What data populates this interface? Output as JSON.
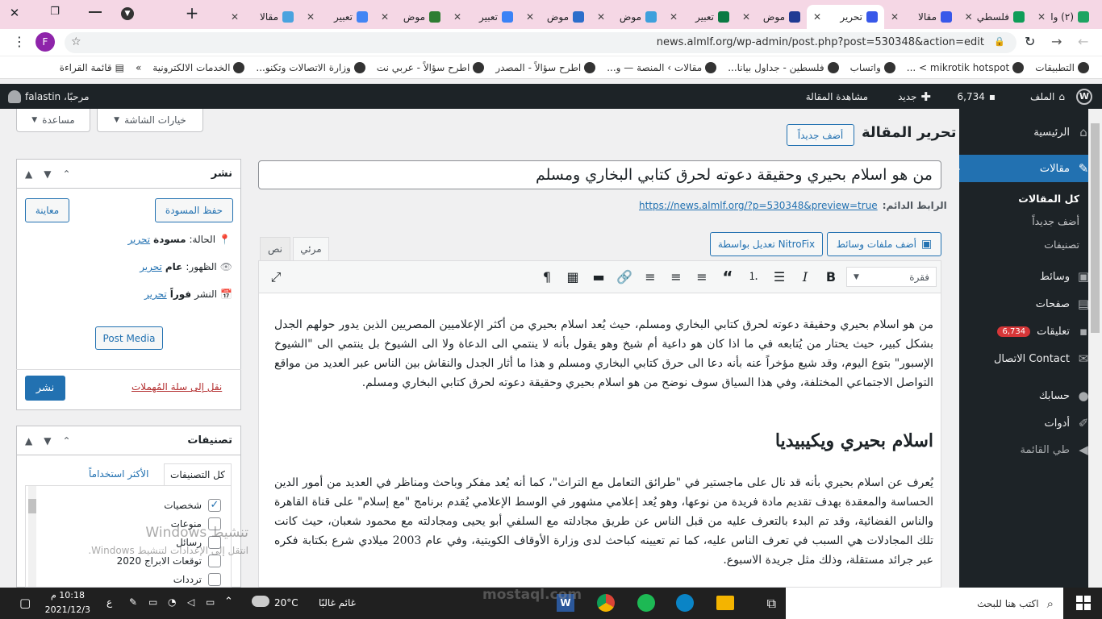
{
  "browser": {
    "tabs": [
      {
        "label": "(٢) وا",
        "color": "#1da462"
      },
      {
        "label": "فلسطي",
        "color": "#0f9d58"
      },
      {
        "label": "مقالا",
        "color": "#3858e9"
      },
      {
        "label": "تحرير",
        "color": "#3858e9",
        "active": true
      },
      {
        "label": "موض",
        "color": "#1f3a93"
      },
      {
        "label": "تعبير",
        "color": "#0b7a43"
      },
      {
        "label": "موض",
        "color": "#3ea0dc"
      },
      {
        "label": "موض",
        "color": "#2c6ecb"
      },
      {
        "label": "تعبير",
        "color": "#3b82f6"
      },
      {
        "label": "موض",
        "color": "#2e7d32"
      },
      {
        "label": "تعبير",
        "color": "#4285f4"
      },
      {
        "label": "مقالا",
        "color": "#4aa3df"
      }
    ],
    "url": "news.almlf.org/wp-admin/post.php?post=530348&action=edit",
    "profile_letter": "F",
    "bookmarks": [
      "التطبيقات",
      "mikrotik hotspot > ...",
      "واتساب",
      "فلسطين - جداول بيانا...",
      "مقالات › المنصة — و...",
      "اطرح سؤالاً - المصدر",
      "اطرح سؤالاً - عربي نت",
      "وزارة الاتصالات وتكنو...",
      "الخدمات الالكترونية"
    ],
    "bookmarks_more": "»",
    "reading_list": "قائمة القراءة"
  },
  "adminbar": {
    "site": "الملف",
    "comments": "6,734",
    "new": "جديد",
    "view": "مشاهدة المقالة",
    "greeting": "مرحبًا، falastin"
  },
  "sidebar": {
    "items": [
      {
        "label": "الرئيسية",
        "icon": "⌂"
      },
      {
        "label": "مقالات",
        "icon": "✎"
      },
      {
        "label": "وسائط",
        "icon": "▣"
      },
      {
        "label": "صفحات",
        "icon": "▤"
      },
      {
        "label": "تعليقات",
        "icon": "✉"
      },
      {
        "label": "Contact الاتصال",
        "icon": "✉"
      },
      {
        "label": "حسابك",
        "icon": "●"
      },
      {
        "label": "أدوات",
        "icon": "✐"
      },
      {
        "label": "طي القائمة",
        "icon": "◀"
      }
    ],
    "sub": [
      "كل المقالات",
      "أضف جديداً",
      "تصنيفات"
    ],
    "comments_badge": "6,734"
  },
  "top": {
    "screen_options": "خيارات الشاشة",
    "help": "مساعدة",
    "page_title": "تحرير المقالة",
    "add_new": "أضف جديداً"
  },
  "post": {
    "title": "من هو اسلام بحيري وحقيقة دعوته لحرق كتابي البخاري ومسلم",
    "permalink_label": "الرابط الدائم:",
    "permalink": "https://news.almlf.org/?p=530348&preview=true",
    "add_media": "أضف ملفات وسائط",
    "nitrofix": "تعديل بواسطة NitroFix",
    "tab_visual": "مرئي",
    "tab_text": "نص",
    "format": "فقرة",
    "para1": "من هو اسلام بحيري وحقيقة دعوته لحرق كتابي البخاري ومسلم، حيث يُعد اسلام بحيري من أكثر الإعلاميين المصريين الذين يدور حولهم الجدل بشكل كبير، حيث يحتار من يُتابعه في ما اذا كان هو داعية أم شيخ وهو يقول بأنه لا ينتمي الى الدعاة ولا الى الشيوخ بل ينتمي الى \"الشيوخ الإسبور\" بتوع اليوم، وقد شيع مؤخراً عنه بأنه دعا الى حرق كتابي البخاري ومسلم و هذا ما أثار الجدل والنقاش بين الناس عبر العديد من مواقع التواصل الاجتماعي المختلفة، وفي هذا السياق سوف نوضح من هو اسلام بحيري وحقيقة دعوته لحرق كتابي البخاري ومسلم.",
    "heading": "اسلام بحيري ويكيبيديا",
    "para2": "يُعرف عن اسلام بحيري بأنه قد نال على ماجستير في \"طرائق التعامل مع التراث\"، كما أنه يُعد مفكر وباحث ومناظر في العديد من أمور الدين الحساسة والمعقدة بهدف تقديم مادة فريدة من نوعها، وهو يُعد إعلامي مشهور في الوسط الإعلامي يُقدم برنامج \"مع إسلام\" على قناة القاهرة والناس الفضائية، وقد تم البدء بالتعرف عليه من قبل الناس عن طريق مجادلته مع السلفي أبو يحيى ومجادلته مع محمود شعبان، حيث كانت تلك المجادلات هي السبب في تعرف الناس عليه، كما تم تعيينه كباحث لدى وزارة الأوقاف الكويتية، وفي عام 2003 ميلادي شرع بكتابة فكره عبر جرائد مستقلة، وذلك مثل جريدة الاسبوع."
  },
  "publish": {
    "title": "نشر",
    "save_draft": "حفظ المسودة",
    "preview": "معاينة",
    "status_label": "الحالة:",
    "status_value": "مسودة",
    "visibility_label": "الظهور:",
    "visibility_value": "عام",
    "schedule_label": "النشر",
    "schedule_value": "فوراً",
    "edit": "تحرير",
    "post_media": "Post Media",
    "trash": "نقل إلى سلة المُهملات",
    "publish_btn": "نشر"
  },
  "categories": {
    "title": "تصنيفات",
    "tab_all": "كل التصنيفات",
    "tab_popular": "الأكثر استخداماً",
    "items": [
      {
        "label": "شخصيات",
        "checked": true
      },
      {
        "label": "منوعات",
        "checked": false
      },
      {
        "label": "رسائل",
        "checked": false
      },
      {
        "label": "توقعات الابراج 2020",
        "checked": false
      },
      {
        "label": "ترددات",
        "checked": false
      }
    ]
  },
  "watermark": {
    "line1": "تنشيط Windows",
    "line2": "انتقل إلى الإعدادات لتنشيط Windows."
  },
  "logo_text": "mostaql.com",
  "taskbar": {
    "search": "اكتب هنا للبحث",
    "weather": "غائم غالبًا",
    "temp": "20°C",
    "lang": "ع",
    "time": "10:18 م",
    "date": "2021/12/3"
  }
}
